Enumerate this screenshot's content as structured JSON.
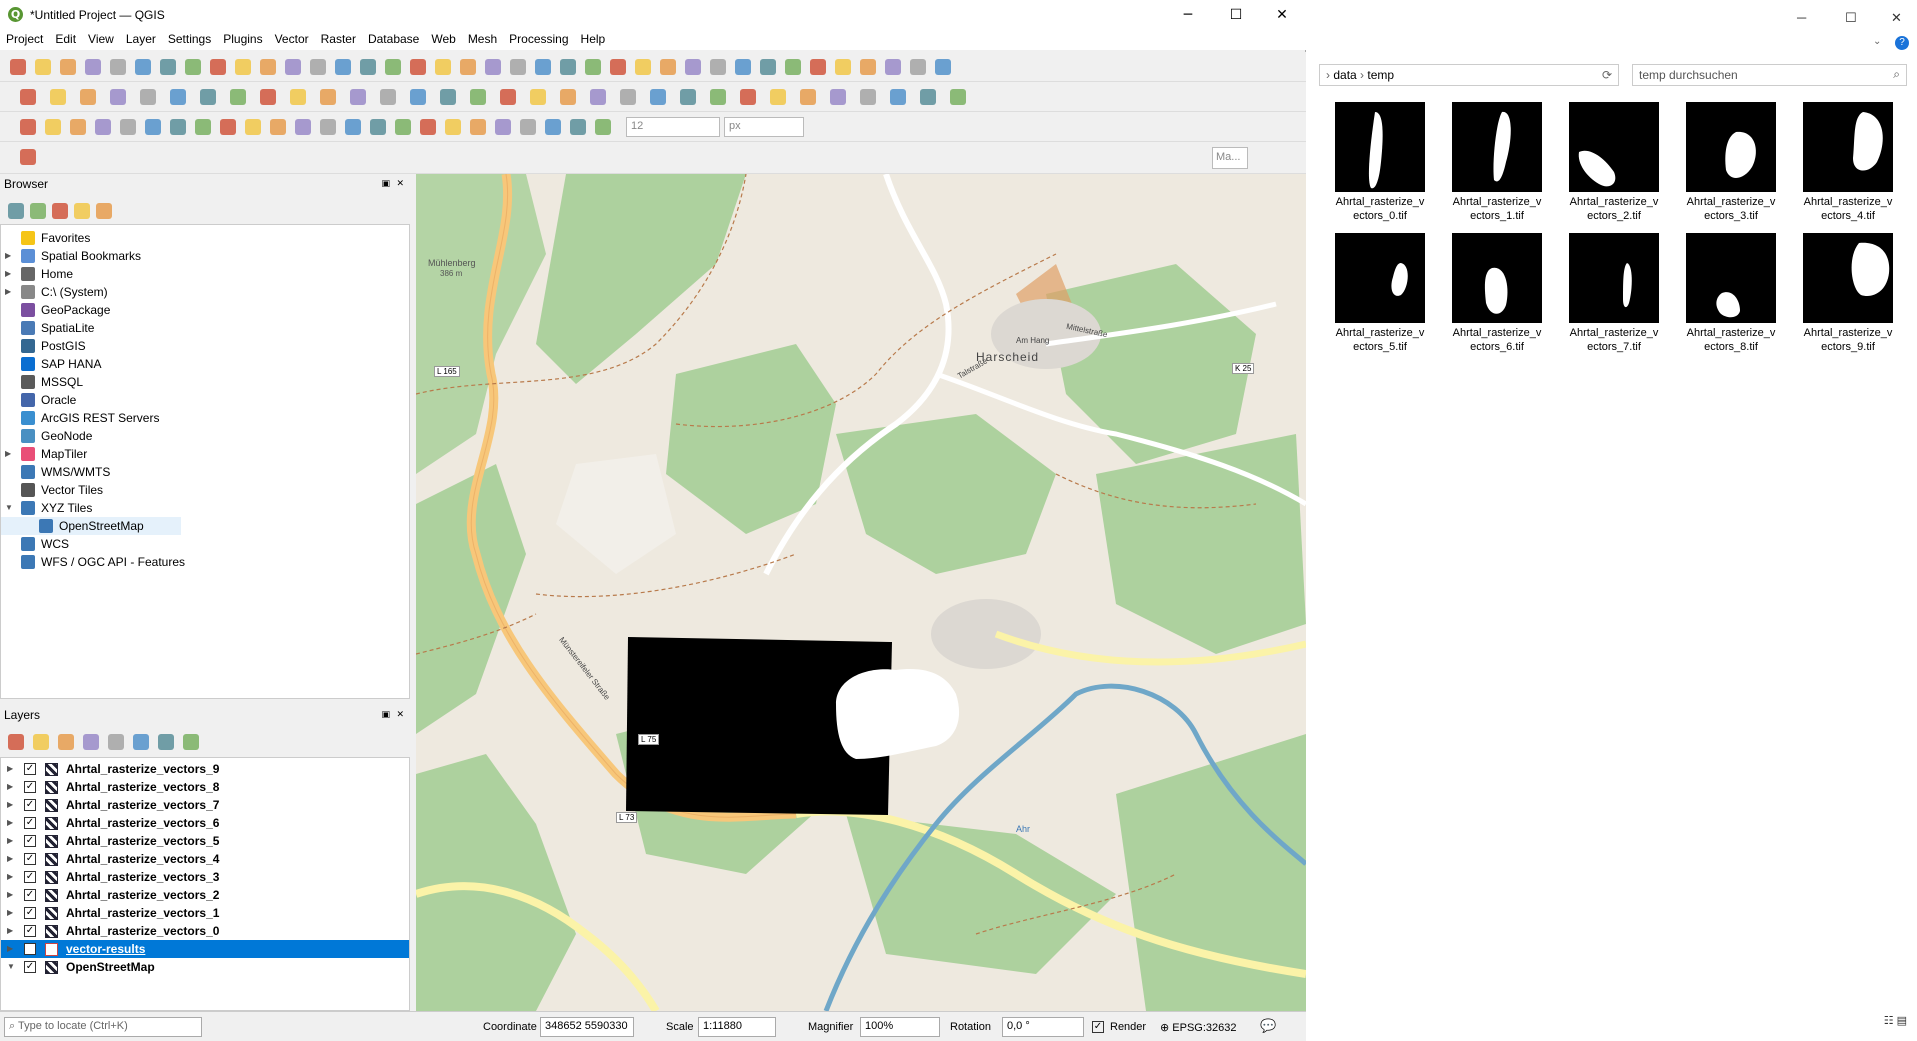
{
  "window": {
    "title": "*Untitled Project — QGIS",
    "min": "─",
    "max": "☐",
    "close": "✕"
  },
  "menu": [
    "Project",
    "Edit",
    "View",
    "Layer",
    "Settings",
    "Plugins",
    "Vector",
    "Raster",
    "Database",
    "Web",
    "Mesh",
    "Processing",
    "Help"
  ],
  "toolbar": {
    "snap_value": "12",
    "snap_unit": "px",
    "search_placeholder": "Ma..."
  },
  "browser": {
    "title": "Browser",
    "items": [
      {
        "label": "Favorites",
        "icon": "star-icon",
        "color": "#f5c518",
        "expand": false
      },
      {
        "label": "Spatial Bookmarks",
        "icon": "bookmark-icon",
        "color": "#5b8fd6",
        "expand": true
      },
      {
        "label": "Home",
        "icon": "home-icon",
        "color": "#666",
        "expand": true
      },
      {
        "label": "C:\\ (System)",
        "icon": "drive-icon",
        "color": "#888",
        "expand": true
      },
      {
        "label": "GeoPackage",
        "icon": "geopackage-icon",
        "color": "#7b4fa0",
        "expand": false
      },
      {
        "label": "SpatiaLite",
        "icon": "spatialite-icon",
        "color": "#4a7ab5",
        "expand": false
      },
      {
        "label": "PostGIS",
        "icon": "postgis-icon",
        "color": "#336791",
        "expand": false
      },
      {
        "label": "SAP HANA",
        "icon": "hana-icon",
        "color": "#0a6ed1",
        "expand": false
      },
      {
        "label": "MSSQL",
        "icon": "mssql-icon",
        "color": "#5a5a5a",
        "expand": false
      },
      {
        "label": "Oracle",
        "icon": "oracle-icon",
        "color": "#4466aa",
        "expand": false
      },
      {
        "label": "ArcGIS REST Servers",
        "icon": "arcgis-icon",
        "color": "#3a8fd0",
        "expand": false
      },
      {
        "label": "GeoNode",
        "icon": "geonode-icon",
        "color": "#4a90c2",
        "expand": false
      },
      {
        "label": "MapTiler",
        "icon": "maptiler-icon",
        "color": "#e94e77",
        "expand": true
      },
      {
        "label": "WMS/WMTS",
        "icon": "wms-icon",
        "color": "#3c78b5",
        "expand": false
      },
      {
        "label": "Vector Tiles",
        "icon": "vector-tiles-icon",
        "color": "#555",
        "expand": false
      },
      {
        "label": "XYZ Tiles",
        "icon": "xyz-tiles-icon",
        "color": "#3c78b5",
        "expand": true,
        "open": true
      },
      {
        "label": "OpenStreetMap",
        "icon": "osm-tile-icon",
        "color": "#3c78b5",
        "child": true
      },
      {
        "label": "WCS",
        "icon": "wcs-icon",
        "color": "#3c78b5",
        "expand": false
      },
      {
        "label": "WFS / OGC API - Features",
        "icon": "wfs-icon",
        "color": "#3c78b5",
        "expand": false
      }
    ]
  },
  "layers": {
    "title": "Layers",
    "items": [
      {
        "label": "Ahrtal_rasterize_vectors_9"
      },
      {
        "label": "Ahrtal_rasterize_vectors_8"
      },
      {
        "label": "Ahrtal_rasterize_vectors_7"
      },
      {
        "label": "Ahrtal_rasterize_vectors_6"
      },
      {
        "label": "Ahrtal_rasterize_vectors_5"
      },
      {
        "label": "Ahrtal_rasterize_vectors_4"
      },
      {
        "label": "Ahrtal_rasterize_vectors_3"
      },
      {
        "label": "Ahrtal_rasterize_vectors_2"
      },
      {
        "label": "Ahrtal_rasterize_vectors_1"
      },
      {
        "label": "Ahrtal_rasterize_vectors_0"
      },
      {
        "label": "vector-results",
        "selected": true
      },
      {
        "label": "OpenStreetMap"
      }
    ]
  },
  "map_labels": {
    "place": "Harscheid",
    "hill": "Mühlenberg",
    "hill_elev": "386 m",
    "road1": "L 165",
    "road2": "L 75",
    "road3": "L 73",
    "road4": "K 25",
    "street1": "Münstereifeler Straße",
    "street2": "Mittelstraße",
    "street3": "Talstraße",
    "river": "Ahr",
    "street4": "Am Hang"
  },
  "status": {
    "locate_placeholder": "Type to locate (Ctrl+K)",
    "coord_label": "Coordinate",
    "coord": "348652 5590330",
    "scale_label": "Scale",
    "scale": "1:11880",
    "magnifier_label": "Magnifier",
    "magnifier": "100%",
    "rotation_label": "Rotation",
    "rotation": "0,0 °",
    "render_label": "Render",
    "crs": "EPSG:32632"
  },
  "explorer": {
    "path": [
      "data",
      "temp"
    ],
    "search_placeholder": "temp durchsuchen",
    "files": [
      {
        "name1": "Ahrtal_rasterize_v",
        "name2": "ectors_0.tif"
      },
      {
        "name1": "Ahrtal_rasterize_v",
        "name2": "ectors_1.tif"
      },
      {
        "name1": "Ahrtal_rasterize_v",
        "name2": "ectors_2.tif"
      },
      {
        "name1": "Ahrtal_rasterize_v",
        "name2": "ectors_3.tif"
      },
      {
        "name1": "Ahrtal_rasterize_v",
        "name2": "ectors_4.tif"
      },
      {
        "name1": "Ahrtal_rasterize_v",
        "name2": "ectors_5.tif"
      },
      {
        "name1": "Ahrtal_rasterize_v",
        "name2": "ectors_6.tif"
      },
      {
        "name1": "Ahrtal_rasterize_v",
        "name2": "ectors_7.tif"
      },
      {
        "name1": "Ahrtal_rasterize_v",
        "name2": "ectors_8.tif"
      },
      {
        "name1": "Ahrtal_rasterize_v",
        "name2": "ectors_9.tif"
      }
    ]
  }
}
